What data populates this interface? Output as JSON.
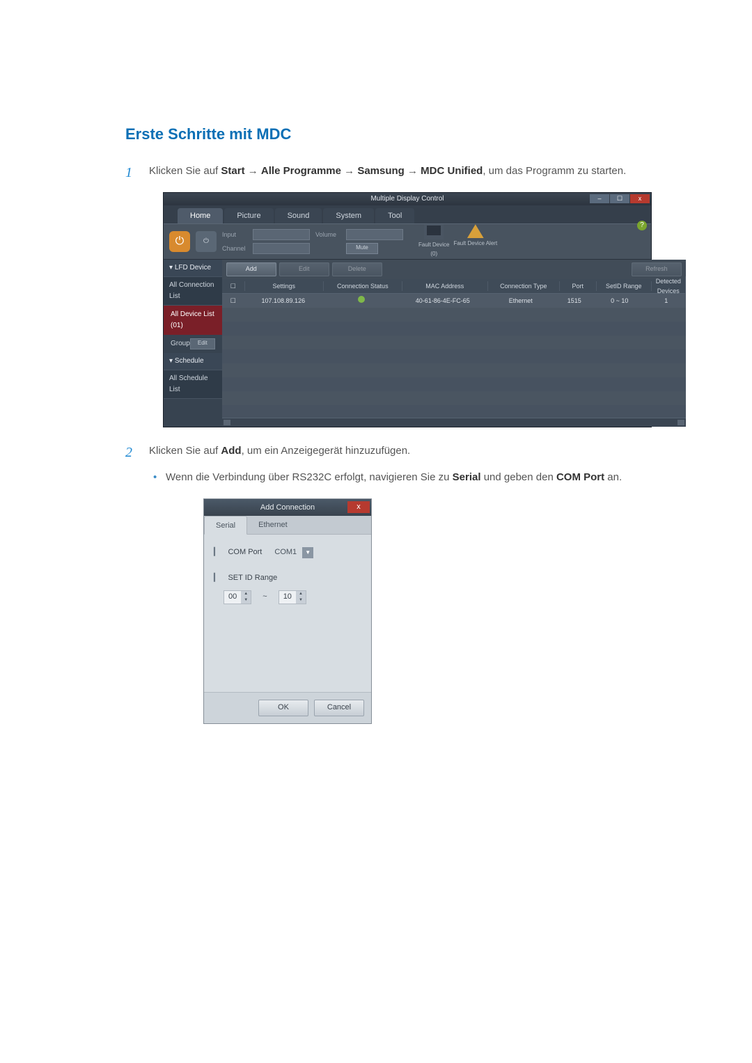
{
  "heading": "Erste Schritte mit MDC",
  "step1": {
    "num": "1",
    "pre": "Klicken Sie auf ",
    "start": "Start",
    "arrow": " → ",
    "alle": "Alle Programme",
    "samsung": "Samsung",
    "mdc": "MDC Unified",
    "post": ", um das Programm zu starten."
  },
  "step2": {
    "num": "2",
    "pre": "Klicken Sie auf ",
    "add": "Add",
    "post": ", um ein Anzeigegerät hinzuzufügen."
  },
  "sub1": {
    "pre": "Wenn die Verbindung über RS232C erfolgt, navigieren Sie zu ",
    "serial": "Serial",
    "mid": " und geben den ",
    "comport": "COM Port",
    "post": " an."
  },
  "mdc": {
    "title": "Multiple Display Control",
    "help": "?",
    "tabs": {
      "home": "Home",
      "picture": "Picture",
      "sound": "Sound",
      "system": "System",
      "tool": "Tool"
    },
    "ribbon": {
      "input": "Input",
      "channel": "Channel",
      "volume": "Volume",
      "mute": "Mute"
    },
    "fault": {
      "device": "Fault Device",
      "count": "(0)",
      "alert": "Fault Device Alert"
    },
    "side": {
      "lfd": "LFD Device",
      "allconn": "All Connection List",
      "alldev": "All Device List (01)",
      "group": "Group",
      "edit": "Edit",
      "schedule": "Schedule",
      "allsched": "All Schedule List"
    },
    "toolbar": {
      "add": "Add",
      "edit": "Edit",
      "delete": "Delete",
      "refresh": "Refresh"
    },
    "cols": {
      "settings": "Settings",
      "conn": "Connection Status",
      "mac": "MAC Address",
      "type": "Connection Type",
      "port": "Port",
      "range": "SetID Range",
      "det": "Detected Devices"
    },
    "row": {
      "ip": "107.108.89.126",
      "mac": "40-61-86-4E-FC-65",
      "type": "Ethernet",
      "port": "1515",
      "range": "0 ~ 10",
      "det": "1"
    },
    "chevron": "▾"
  },
  "dlg": {
    "title": "Add Connection",
    "close": "x",
    "tabs": {
      "serial": "Serial",
      "ethernet": "Ethernet"
    },
    "comport_label": "COM Port",
    "comport_value": "COM1",
    "setid_label": "SET ID Range",
    "range_from": "00",
    "range_sep": "~",
    "range_to": "10",
    "ok": "OK",
    "cancel": "Cancel",
    "dropdown_caret": "▼",
    "spin_up": "▲",
    "spin_down": "▼"
  }
}
